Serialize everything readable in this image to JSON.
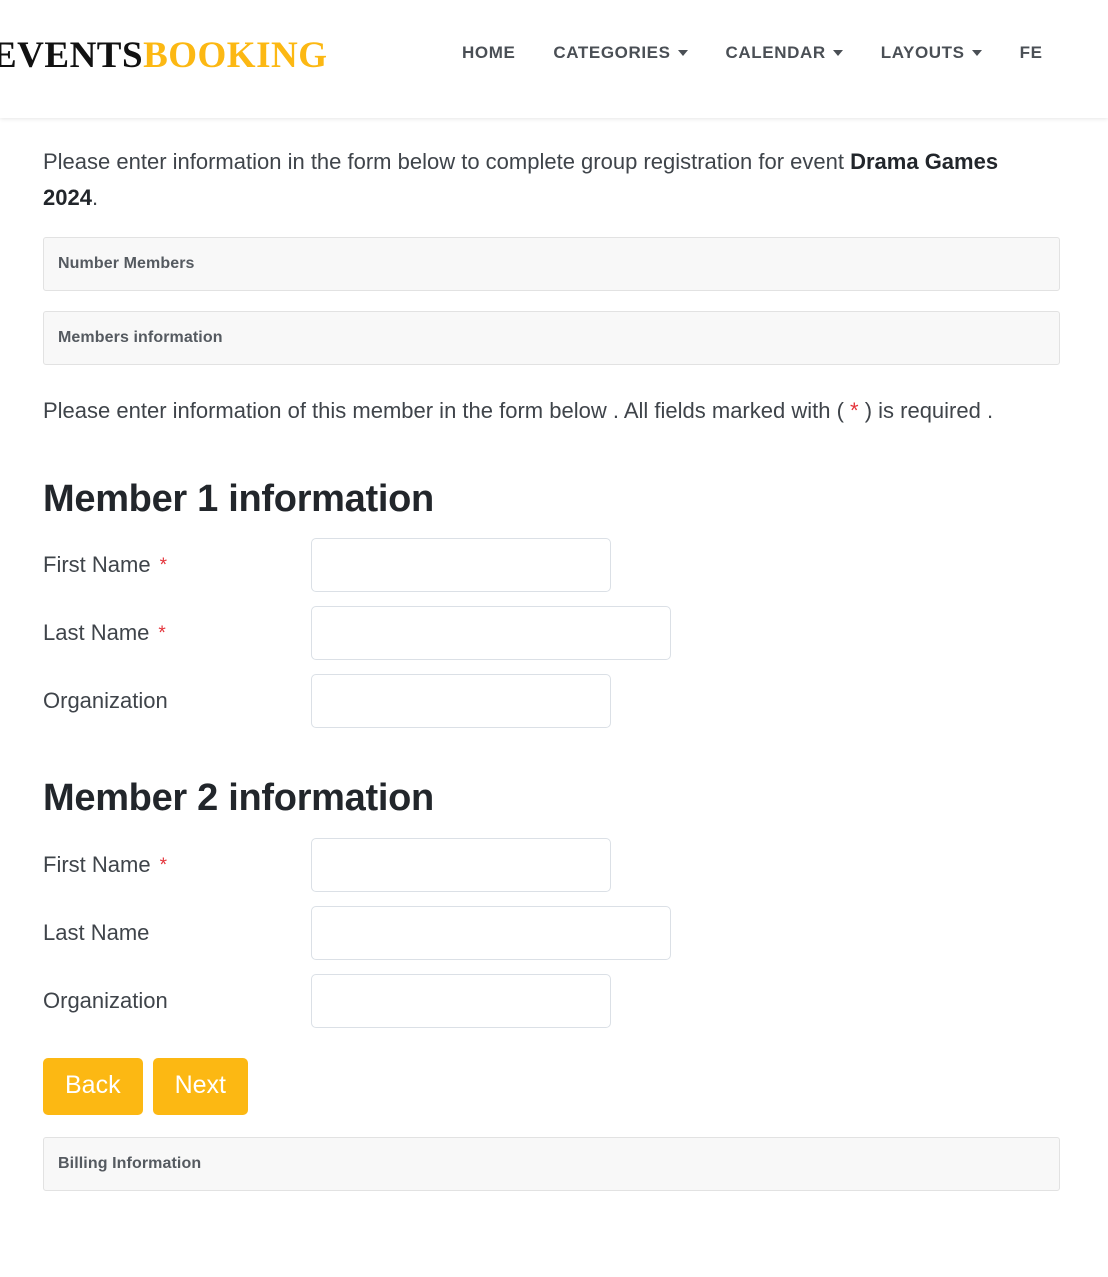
{
  "header": {
    "brand": {
      "part1": "EVENTS",
      "part2": "BOOKING"
    },
    "nav": [
      {
        "label": "HOME",
        "has_caret": false,
        "name": "nav-item-home"
      },
      {
        "label": "CATEGORIES",
        "has_caret": true,
        "name": "nav-item-categories"
      },
      {
        "label": "CALENDAR",
        "has_caret": true,
        "name": "nav-item-calendar"
      },
      {
        "label": "LAYOUTS",
        "has_caret": true,
        "name": "nav-item-layouts"
      },
      {
        "label": "FE",
        "has_caret": false,
        "name": "nav-item-features-truncated"
      }
    ]
  },
  "intro": {
    "line_prefix": "Please enter information in the form below to complete group registration for event ",
    "event_name": "Drama Games 2024",
    "line_suffix": "."
  },
  "panels": {
    "number_members": "Number Members",
    "members_information": "Members information",
    "billing_information": "Billing Information"
  },
  "note": {
    "part1": "Please enter information of this member in the form below . All fields marked with ( ",
    "star": "*",
    "part2": " ) is required ."
  },
  "members": [
    {
      "heading": "Member 1 information",
      "fields": [
        {
          "label": "First Name",
          "required": true,
          "required_mark": "*",
          "value": "",
          "placeholder": "",
          "width": "w-300",
          "name": "member-1-first-name-input"
        },
        {
          "label": "Last Name",
          "required": true,
          "required_mark": "*",
          "value": "",
          "placeholder": "",
          "width": "w-360",
          "name": "member-1-last-name-input"
        },
        {
          "label": "Organization",
          "required": false,
          "required_mark": "",
          "value": "",
          "placeholder": "",
          "width": "w-300",
          "name": "member-1-organization-input"
        }
      ]
    },
    {
      "heading": "Member 2 information",
      "fields": [
        {
          "label": "First Name",
          "required": true,
          "required_mark": "*",
          "value": "",
          "placeholder": "",
          "width": "w-300",
          "name": "member-2-first-name-input"
        },
        {
          "label": "Last Name",
          "required": false,
          "required_mark": "",
          "value": "",
          "placeholder": "",
          "width": "w-360",
          "name": "member-2-last-name-input"
        },
        {
          "label": "Organization",
          "required": false,
          "required_mark": "",
          "value": "",
          "placeholder": "",
          "width": "w-300",
          "name": "member-2-organization-input"
        }
      ]
    }
  ],
  "buttons": {
    "back": "Back",
    "next": "Next"
  },
  "colors": {
    "brand_accent": "#fcb813",
    "button_bg": "#fcb813",
    "required_star": "#e4333a",
    "panel_bg": "#f8f8f8",
    "panel_border": "#e2e2e2",
    "input_border": "#dbe0e6",
    "text": "#3f444a"
  }
}
